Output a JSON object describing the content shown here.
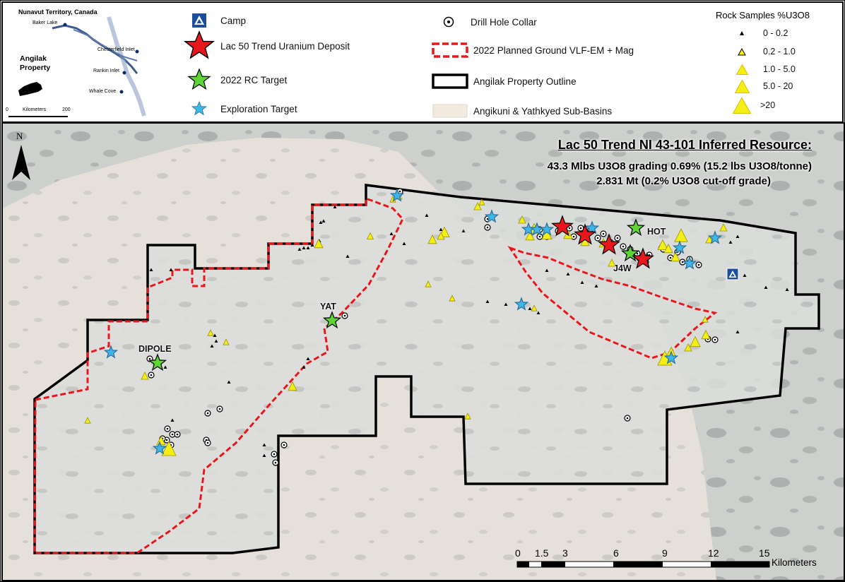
{
  "inset": {
    "title": "Nunavut Territory, Canada",
    "places": [
      "Baker Lake",
      "Chesterfield Inlet",
      "Rankin Inlet",
      "Whale Cove"
    ],
    "property_label_1": "Angilak",
    "property_label_2": "Property",
    "scale_unit": "Kilometers",
    "scale_start": "0",
    "scale_end": "200"
  },
  "legend": {
    "camp": "Camp",
    "deposit": "Lac 50 Trend Uranium Deposit",
    "rc_target": "2022 RC Target",
    "exploration_target": "Exploration Target",
    "drill_hole": "Drill Hole Collar",
    "planned_survey": "2022 Planned Ground VLF-EM + Mag",
    "property_outline": "Angilak Property Outline",
    "sub_basins": "Angikuni & Yathkyed Sub-Basins",
    "rock_title": "Rock Samples %U3O8",
    "rock_classes": [
      "0 - 0.2",
      "0.2 - 1.0",
      "1.0 - 5.0",
      "5.0 - 20",
      ">20"
    ]
  },
  "colors": {
    "deposit_red": "#e8171b",
    "rc_green": "#5fd435",
    "target_blue": "#3fb6e8",
    "sample_yellow": "#f5ee15",
    "survey_red": "#e8171b",
    "camp_blue": "#1d4e9e",
    "basin_fill": "#f3ebe0"
  },
  "resource": {
    "title": "Lac 50 Trend NI 43-101 Inferred Resource:",
    "line1": "43.3 Mlbs U3O8 grading 0.69% (15.2 lbs U3O8/tonne)",
    "line2": "2.831 Mt (0.2% U3O8 cut-off grade)"
  },
  "north": "N",
  "labels": {
    "dipole": "DIPOLE",
    "yat": "YAT",
    "hot": "HOT",
    "j4w": "J4W"
  },
  "scalebar": {
    "ticks": [
      "0",
      "1.5",
      "3",
      "6",
      "9",
      "12",
      "15"
    ],
    "unit": "Kilometers"
  }
}
